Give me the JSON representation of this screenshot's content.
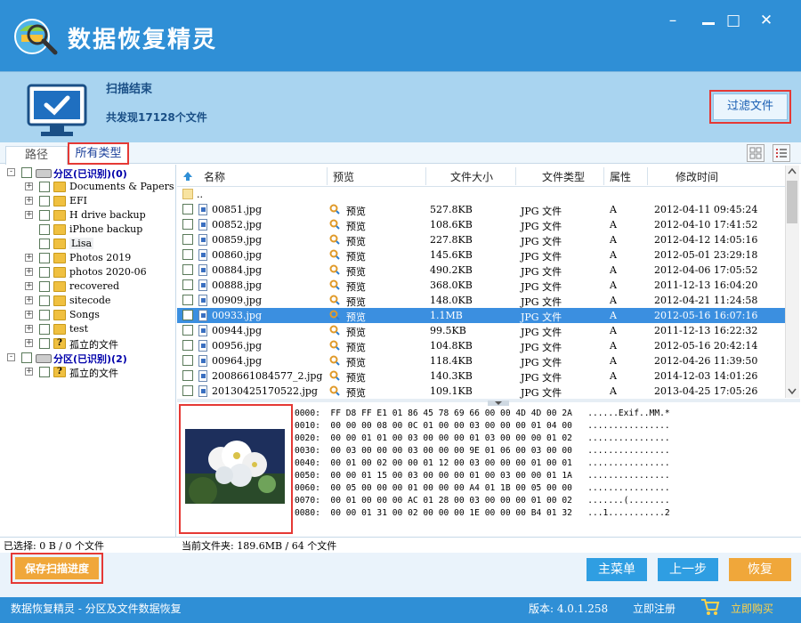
{
  "app": {
    "title": "数据恢复精灵"
  },
  "window": {
    "minimize": "–",
    "maximize": "□",
    "close": "✕"
  },
  "scan": {
    "status": "扫描结束",
    "count": "共发现17128个文件"
  },
  "filter_button": "过滤文件",
  "tabs": [
    {
      "label": "路径"
    },
    {
      "label": "所有类型"
    }
  ],
  "tree": [
    {
      "label": "分区(已识别)(0)",
      "kind": "drive",
      "level": 0,
      "expand": "-"
    },
    {
      "label": "Documents & Papers",
      "kind": "folder",
      "level": 1,
      "expand": "+"
    },
    {
      "label": "EFI",
      "kind": "folder",
      "level": 1,
      "expand": "+"
    },
    {
      "label": "H drive backup",
      "kind": "folder",
      "level": 1,
      "expand": "+"
    },
    {
      "label": "iPhone backup",
      "kind": "folder",
      "level": 1,
      "expand": ""
    },
    {
      "label": "Lisa",
      "kind": "folder",
      "level": 1,
      "expand": "",
      "selected": true
    },
    {
      "label": "Photos 2019",
      "kind": "folder",
      "level": 1,
      "expand": "+"
    },
    {
      "label": "photos 2020-06",
      "kind": "folder",
      "level": 1,
      "expand": "+"
    },
    {
      "label": "recovered",
      "kind": "folder",
      "level": 1,
      "expand": "+"
    },
    {
      "label": "sitecode",
      "kind": "folder",
      "level": 1,
      "expand": "+"
    },
    {
      "label": "Songs",
      "kind": "folder",
      "level": 1,
      "expand": "+"
    },
    {
      "label": "test",
      "kind": "folder",
      "level": 1,
      "expand": "+"
    },
    {
      "label": "孤立的文件",
      "kind": "orphan",
      "level": 1,
      "expand": "+"
    },
    {
      "label": "分区(已识别)(2)",
      "kind": "drive",
      "level": 0,
      "expand": "-"
    },
    {
      "label": "孤立的文件",
      "kind": "orphan",
      "level": 1,
      "expand": "+"
    }
  ],
  "columns": {
    "name": "名称",
    "preview": "预览",
    "size": "文件大小",
    "type": "文件类型",
    "attr": "属性",
    "modified": "修改时间"
  },
  "parent_dir": "..",
  "files": [
    {
      "name": "00851.jpg",
      "preview": "预览",
      "size": "527.8KB",
      "type": "JPG 文件",
      "attr": "A",
      "modified": "2012-04-11 09:45:24"
    },
    {
      "name": "00852.jpg",
      "preview": "预览",
      "size": "108.6KB",
      "type": "JPG 文件",
      "attr": "A",
      "modified": "2012-04-10 17:41:52"
    },
    {
      "name": "00859.jpg",
      "preview": "预览",
      "size": "227.8KB",
      "type": "JPG 文件",
      "attr": "A",
      "modified": "2012-04-12 14:05:16"
    },
    {
      "name": "00860.jpg",
      "preview": "预览",
      "size": "145.6KB",
      "type": "JPG 文件",
      "attr": "A",
      "modified": "2012-05-01 23:29:18"
    },
    {
      "name": "00884.jpg",
      "preview": "预览",
      "size": "490.2KB",
      "type": "JPG 文件",
      "attr": "A",
      "modified": "2012-04-06 17:05:52"
    },
    {
      "name": "00888.jpg",
      "preview": "预览",
      "size": "368.0KB",
      "type": "JPG 文件",
      "attr": "A",
      "modified": "2011-12-13 16:04:20"
    },
    {
      "name": "00909.jpg",
      "preview": "预览",
      "size": "148.0KB",
      "type": "JPG 文件",
      "attr": "A",
      "modified": "2012-04-21 11:24:58"
    },
    {
      "name": "00933.jpg",
      "preview": "预览",
      "size": "1.1MB",
      "type": "JPG 文件",
      "attr": "A",
      "modified": "2012-05-16 16:07:16",
      "selected": true
    },
    {
      "name": "00944.jpg",
      "preview": "预览",
      "size": "99.5KB",
      "type": "JPG 文件",
      "attr": "A",
      "modified": "2011-12-13 16:22:32"
    },
    {
      "name": "00956.jpg",
      "preview": "预览",
      "size": "104.8KB",
      "type": "JPG 文件",
      "attr": "A",
      "modified": "2012-05-16 20:42:14"
    },
    {
      "name": "00964.jpg",
      "preview": "预览",
      "size": "118.4KB",
      "type": "JPG 文件",
      "attr": "A",
      "modified": "2012-04-26 11:39:50"
    },
    {
      "name": "2008661084577_2.jpg",
      "preview": "预览",
      "size": "140.3KB",
      "type": "JPG 文件",
      "attr": "A",
      "modified": "2014-12-03 14:01:26"
    },
    {
      "name": "20130425170522.jpg",
      "preview": "预览",
      "size": "109.1KB",
      "type": "JPG 文件",
      "attr": "A",
      "modified": "2013-04-25 17:05:26"
    }
  ],
  "hex": [
    "0000:  FF D8 FF E1 01 86 45 78 69 66 00 00 4D 4D 00 2A   ......Exif..MM.*",
    "0010:  00 00 00 08 00 0C 01 00 00 03 00 00 00 01 04 00   ................",
    "0020:  00 00 01 01 00 03 00 00 00 01 03 00 00 00 01 02   ................",
    "0030:  00 03 00 00 00 03 00 00 00 9E 01 06 00 03 00 00   ................",
    "0040:  00 01 00 02 00 00 01 12 00 03 00 00 00 01 00 01   ................",
    "0050:  00 00 01 15 00 03 00 00 00 01 00 03 00 00 01 1A   ................",
    "0060:  00 05 00 00 00 01 00 00 00 A4 01 1B 00 05 00 00   ................",
    "0070:  00 01 00 00 00 AC 01 28 00 03 00 00 00 01 00 02   .......(........",
    "0080:  00 00 01 31 00 02 00 00 00 1E 00 00 00 B4 01 32   ...1...........2"
  ],
  "status": {
    "selected": "已选择: 0 B / 0 个文件",
    "current_folder": "当前文件夹: 189.6MB / 64 个文件"
  },
  "buttons": {
    "save_progress": "保存扫描进度",
    "main_menu": "主菜单",
    "prev_step": "上一步",
    "recover": "恢复"
  },
  "footer": {
    "title": "数据恢复精灵 - 分区及文件数据恢复",
    "version": "版本: 4.0.1.258",
    "register": "立即注册",
    "buy": "立即购买"
  },
  "colors": {
    "header_blue": "#2f8fd6",
    "band_blue": "#a9d4f0",
    "button_blue": "#2f9ee2",
    "recover_orange": "#f0a73a",
    "highlight_red": "#e53935",
    "selected_row": "#3b8fe0"
  }
}
